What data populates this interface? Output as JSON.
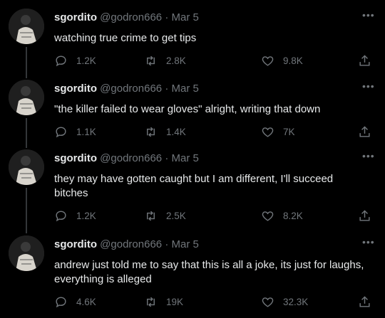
{
  "tweets": [
    {
      "display_name": "sgordito",
      "handle": "@godron666",
      "date": "Mar 5",
      "text": "watching true crime to get tips",
      "replies": "1.2K",
      "retweets": "2.8K",
      "likes": "9.8K"
    },
    {
      "display_name": "sgordito",
      "handle": "@godron666",
      "date": "Mar 5",
      "text": "\"the killer failed to wear gloves\" alright, writing that down",
      "replies": "1.1K",
      "retweets": "1.4K",
      "likes": "7K"
    },
    {
      "display_name": "sgordito",
      "handle": "@godron666",
      "date": "Mar 5",
      "text": "they may have gotten caught but I am different, I'll succeed bitches",
      "replies": "1.2K",
      "retweets": "2.5K",
      "likes": "8.2K"
    },
    {
      "display_name": "sgordito",
      "handle": "@godron666",
      "date": "Mar 5",
      "text": "andrew just told me to say that this is all a joke, its just for laughs, everything is alleged",
      "replies": "4.6K",
      "retweets": "19K",
      "likes": "32.3K"
    }
  ],
  "icons": {
    "reply": "reply-icon",
    "retweet": "retweet-icon",
    "like": "heart-icon",
    "share": "share-icon",
    "more": "more-icon"
  },
  "colors": {
    "background": "#000000",
    "text": "#e7e9ea",
    "muted": "#71767b",
    "thread_line": "#333639"
  }
}
